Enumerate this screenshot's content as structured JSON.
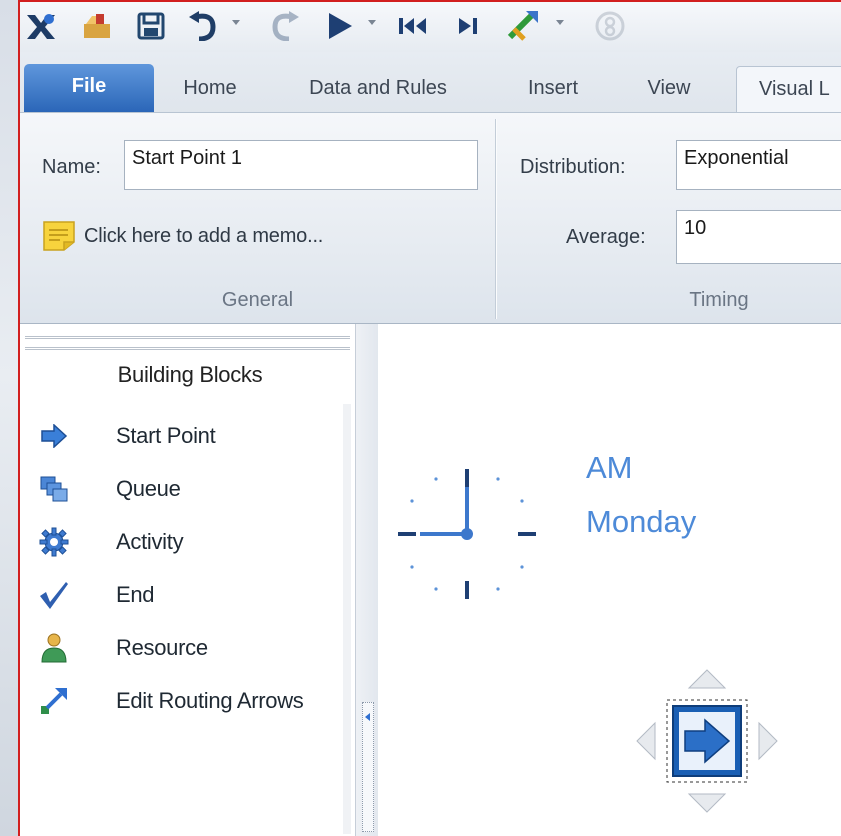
{
  "toolbar": {
    "icons": [
      "app-icon",
      "open-icon",
      "save-icon",
      "undo-icon",
      "redo-icon",
      "run-icon",
      "reset-icon",
      "step-icon",
      "animation-icon",
      "help-icon"
    ]
  },
  "tabs": [
    {
      "label": "File"
    },
    {
      "label": "Home"
    },
    {
      "label": "Data and Rules"
    },
    {
      "label": "Insert"
    },
    {
      "label": "View"
    },
    {
      "label": "Visual L"
    }
  ],
  "ribbon": {
    "general": {
      "name_label": "Name:",
      "name_value": "Start Point 1",
      "memo_text": "Click here to add a memo...",
      "group_label": "General"
    },
    "timing": {
      "distribution_label": "Distribution:",
      "distribution_value": "Exponential",
      "average_label": "Average:",
      "average_value": "10",
      "group_label": "Timing"
    }
  },
  "building_blocks": {
    "title": "Building Blocks",
    "items": [
      {
        "label": "Start Point",
        "icon": "start-point-icon"
      },
      {
        "label": "Queue",
        "icon": "queue-icon"
      },
      {
        "label": "Activity",
        "icon": "activity-gear-icon"
      },
      {
        "label": "End",
        "icon": "end-check-icon"
      },
      {
        "label": "Resource",
        "icon": "resource-person-icon"
      },
      {
        "label": "Edit Routing Arrows",
        "icon": "routing-arrows-icon"
      }
    ]
  },
  "canvas": {
    "clock_period": "AM",
    "clock_day": "Monday"
  },
  "colors": {
    "file_tab": "#2b66b8",
    "accent_blue": "#4d8ad8",
    "frame_border": "#d21f1f"
  }
}
